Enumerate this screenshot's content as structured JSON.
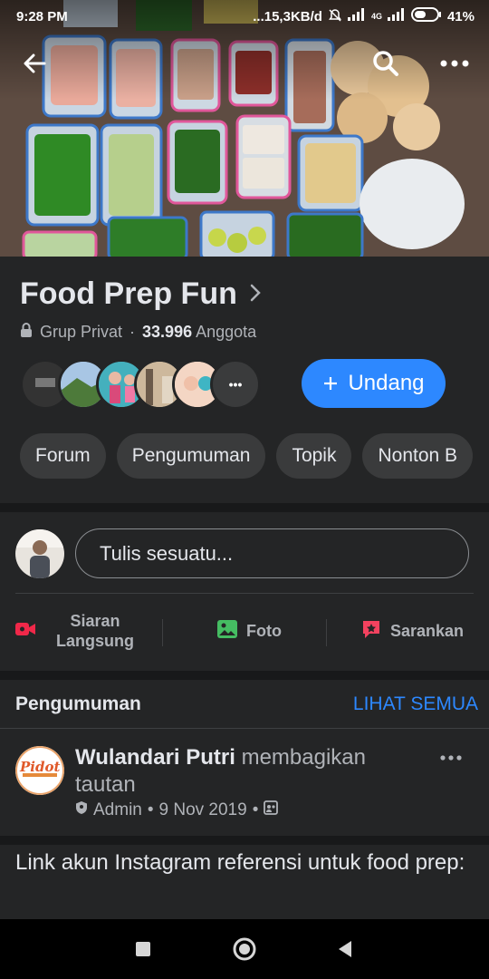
{
  "status_bar": {
    "time": "9:28 PM",
    "network_speed": "...15,3KB/d",
    "network_type": "4G",
    "battery": "41%"
  },
  "header": {
    "back_icon": "arrow-left-icon",
    "search_icon": "search-icon",
    "more_icon": "more-horizontal-icon"
  },
  "group": {
    "name": "Food Prep Fun",
    "privacy": "Grup Privat",
    "separator": "·",
    "member_count": "33.996",
    "member_label": "Anggota",
    "invite_label": "Undang",
    "more_members_glyph": "•••"
  },
  "tabs": [
    {
      "label": "Forum"
    },
    {
      "label": "Pengumuman"
    },
    {
      "label": "Topik"
    },
    {
      "label": "Nonton B"
    }
  ],
  "composer": {
    "placeholder": "Tulis sesuatu...",
    "actions": [
      {
        "label": "Siaran Langsung",
        "icon": "live-video-icon"
      },
      {
        "label": "Foto",
        "icon": "photo-icon"
      },
      {
        "label": "Sarankan",
        "icon": "suggest-icon"
      }
    ]
  },
  "announcements": {
    "title": "Pengumuman",
    "see_all": "LIHAT SEMUA",
    "post": {
      "author": "Wulandari Putri",
      "action": "membagikan tautan",
      "role": "Admin",
      "date": "9 Nov 2019",
      "dot": "•",
      "text": "Link akun Instagram referensi untuk food prep:",
      "avatar_text": "Pidot"
    }
  },
  "colors": {
    "background": "#242526",
    "separator": "#18191a",
    "accent": "#2d88ff",
    "text_primary": "#e4e6eb",
    "text_secondary": "#b0b3b8",
    "live_red": "#f02849",
    "photo_green": "#45bd62",
    "suggest_pink": "#f3425f"
  }
}
